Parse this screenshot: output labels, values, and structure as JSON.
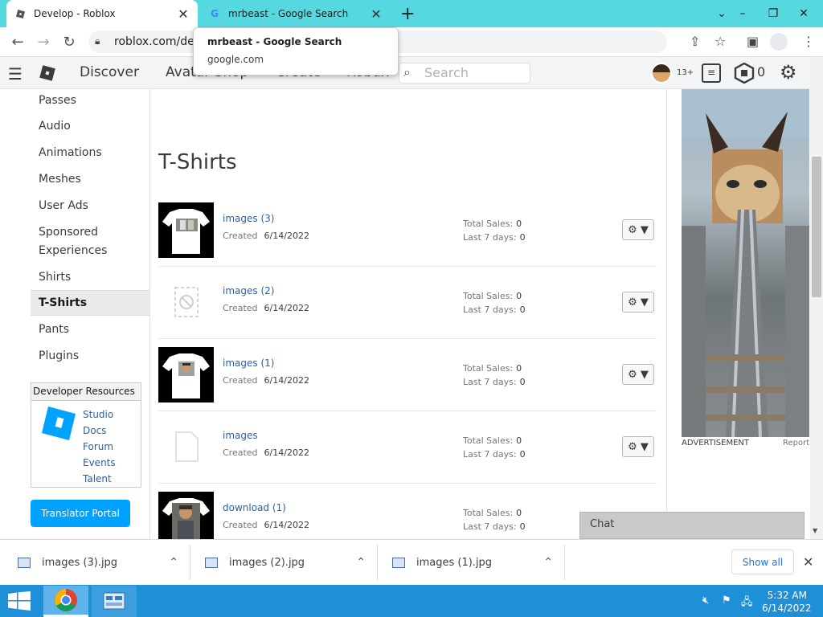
{
  "browser": {
    "tabs": [
      {
        "title": "Develop - Roblox",
        "favicon": "roblox-favicon",
        "active": true
      },
      {
        "title": "mrbeast - Google Search",
        "favicon": "google-favicon",
        "active": false
      }
    ],
    "url": "roblox.com/develop",
    "tooltip": {
      "title": "mrbeast - Google Search",
      "domain": "google.com"
    }
  },
  "roblox_nav": {
    "links": [
      "Discover",
      "Avatar Shop",
      "Create",
      "Robux"
    ],
    "search_placeholder": "Search",
    "age_badge": "13+",
    "robux_count": "0"
  },
  "sidebar": {
    "items": [
      "Passes",
      "Audio",
      "Animations",
      "Meshes",
      "User Ads",
      "Sponsored Experiences",
      "Shirts",
      "T-Shirts",
      "Pants",
      "Plugins"
    ],
    "active": "T-Shirts",
    "dev_resources": {
      "title": "Developer Resources",
      "links": [
        "Studio",
        "Docs",
        "Forum",
        "Events",
        "Talent"
      ]
    },
    "translator_button": "Translator Portal"
  },
  "main": {
    "title": "T-Shirts",
    "items": [
      {
        "name": "images (3)",
        "created_label": "Created",
        "date": "6/14/2022",
        "total_sales_label": "Total Sales:",
        "total_sales": "0",
        "last7_label": "Last 7 days:",
        "last7": "0",
        "thumb": "shirt"
      },
      {
        "name": "images (2)",
        "created_label": "Created",
        "date": "6/14/2022",
        "total_sales_label": "Total Sales:",
        "total_sales": "0",
        "last7_label": "Last 7 days:",
        "last7": "0",
        "thumb": "pending"
      },
      {
        "name": "images (1)",
        "created_label": "Created",
        "date": "6/14/2022",
        "total_sales_label": "Total Sales:",
        "total_sales": "0",
        "last7_label": "Last 7 days:",
        "last7": "0",
        "thumb": "shirt"
      },
      {
        "name": "images",
        "created_label": "Created",
        "date": "6/14/2022",
        "total_sales_label": "Total Sales:",
        "total_sales": "0",
        "last7_label": "Last 7 days:",
        "last7": "0",
        "thumb": "blank"
      },
      {
        "name": "download (1)",
        "created_label": "Created",
        "date": "6/14/2022",
        "total_sales_label": "Total Sales:",
        "total_sales": "0",
        "last7_label": "Last 7 days:",
        "last7": "0",
        "thumb": "photo"
      }
    ]
  },
  "ad": {
    "label": "ADVERTISEMENT",
    "report": "Report"
  },
  "chat": {
    "label": "Chat"
  },
  "downloads": {
    "files": [
      "images (3).jpg",
      "images (2).jpg",
      "images (1).jpg"
    ],
    "show_all": "Show all"
  },
  "taskbar": {
    "time": "5:32 AM",
    "date": "6/14/2022"
  },
  "colors": {
    "tabbar": "#56d8e0",
    "taskbar": "#1f8fd8",
    "link": "#2962a8",
    "translator": "#00a2ff"
  }
}
